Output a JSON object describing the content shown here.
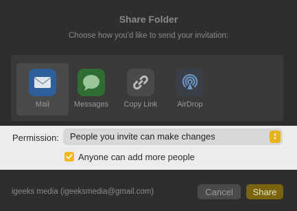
{
  "dialog": {
    "title": "Share Folder",
    "subtitle": "Choose how you'd like to send your invitation:"
  },
  "apps": [
    {
      "label": "Mail",
      "icon": "mail-icon",
      "selected": true
    },
    {
      "label": "Messages",
      "icon": "messages-icon",
      "selected": false
    },
    {
      "label": "Copy Link",
      "icon": "link-icon",
      "selected": false
    },
    {
      "label": "AirDrop",
      "icon": "airdrop-icon",
      "selected": false
    }
  ],
  "permission": {
    "label": "Permission:",
    "value": "People you invite can make changes",
    "checkbox_label": "Anyone can add more people",
    "checkbox_checked": true
  },
  "footer": {
    "account": "igeeks media (igeeksmedia@gmail.com)",
    "cancel_label": "Cancel",
    "share_label": "Share"
  },
  "colors": {
    "accent": "#f3b81d",
    "overlay": "#2e2e2e",
    "highlight_band": "#ececec"
  }
}
